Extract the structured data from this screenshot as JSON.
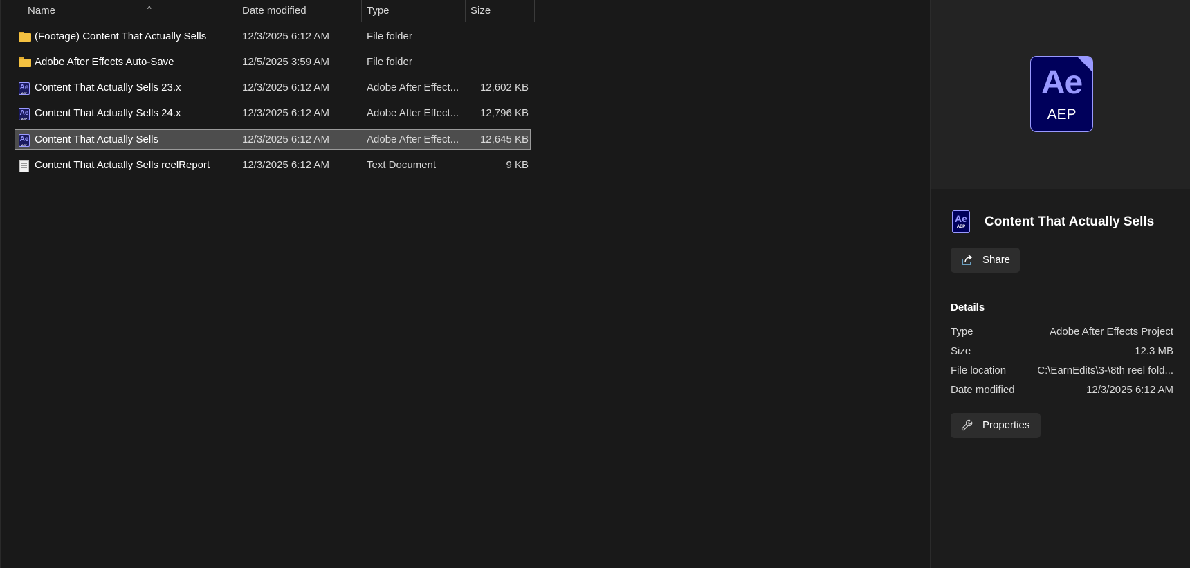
{
  "columns": {
    "name": "Name",
    "date": "Date modified",
    "type": "Type",
    "size": "Size"
  },
  "rows": [
    {
      "icon": "folder-icon",
      "name": "(Footage) Content That Actually Sells",
      "date": "12/3/2025 6:12 AM",
      "type": "File folder",
      "size": ""
    },
    {
      "icon": "folder-icon",
      "name": "Adobe After Effects Auto-Save",
      "date": "12/5/2025 3:59 AM",
      "type": "File folder",
      "size": ""
    },
    {
      "icon": "after-effects-file-icon",
      "name": "Content That Actually Sells 23.x",
      "date": "12/3/2025 6:12 AM",
      "type": "Adobe After Effect...",
      "size": "12,602 KB"
    },
    {
      "icon": "after-effects-file-icon",
      "name": "Content That Actually Sells 24.x",
      "date": "12/3/2025 6:12 AM",
      "type": "Adobe After Effect...",
      "size": "12,796 KB"
    },
    {
      "icon": "after-effects-file-icon",
      "name": "Content That Actually Sells",
      "date": "12/3/2025 6:12 AM",
      "type": "Adobe After Effect...",
      "size": "12,645 KB",
      "selected": true
    },
    {
      "icon": "text-document-icon",
      "name": "Content That Actually Sells reelReport",
      "date": "12/3/2025 6:12 AM",
      "type": "Text Document",
      "size": "9 KB"
    }
  ],
  "preview": {
    "icon_main": "Ae",
    "icon_ext": "AEP"
  },
  "details": {
    "file_title": "Content That Actually Sells",
    "small_icon_main": "Ae",
    "small_icon_ext": "AEP",
    "share_label": "Share",
    "section_title": "Details",
    "fields": [
      {
        "key": "Type",
        "value": "Adobe After Effects Project"
      },
      {
        "key": "Size",
        "value": "12.3 MB"
      },
      {
        "key": "File location",
        "value": "C:\\EarnEdits\\3-\\8th reel fold..."
      },
      {
        "key": "Date modified",
        "value": "12/3/2025 6:12 AM"
      }
    ],
    "properties_label": "Properties"
  },
  "colors": {
    "background": "#191919",
    "selected_row": "#4d4d4d",
    "ae_purple": "#9999ff",
    "ae_navy": "#00005b",
    "folder_yellow": "#f4c141"
  }
}
